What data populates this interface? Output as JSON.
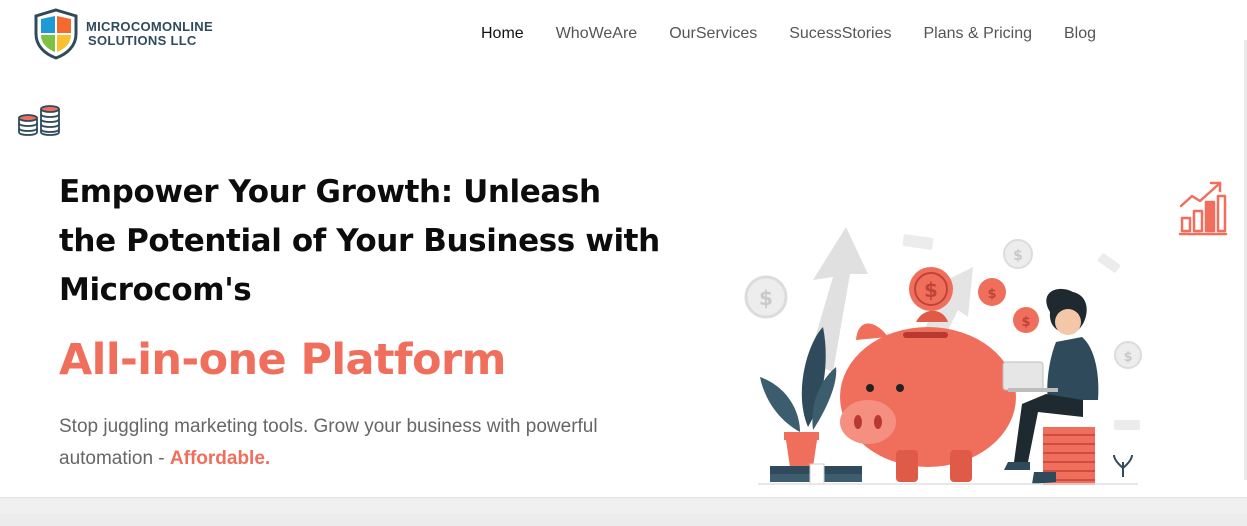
{
  "header": {
    "logo": {
      "line1": "MICROCOMONLINE",
      "line2": "SOLUTIONS LLC"
    },
    "nav": [
      {
        "label": "Home",
        "active": true
      },
      {
        "label": "WhoWeAre",
        "active": false
      },
      {
        "label": "OurServices",
        "active": false
      },
      {
        "label": "SucessStories",
        "active": false
      },
      {
        "label": "Plans & Pricing",
        "active": false
      },
      {
        "label": "Blog",
        "active": false
      }
    ]
  },
  "hero": {
    "headline_lines": [
      "Empower Your Growth: Unleash",
      "the Potential of Your Business with",
      "Microcom's"
    ],
    "subheadline": "All-in-one Platform",
    "description": "Stop juggling marketing tools. Grow your business with powerful automation - ",
    "description_highlight": "Affordable."
  },
  "icons": {
    "left_decor": "coin-stacks-icon",
    "right_decor": "growth-chart-icon",
    "hero_art": "piggy-bank-illustration"
  },
  "colors": {
    "accent": "#f06f5c",
    "dark": "#2f4b5b",
    "text": "#0c0c0c",
    "muted": "#666666"
  }
}
